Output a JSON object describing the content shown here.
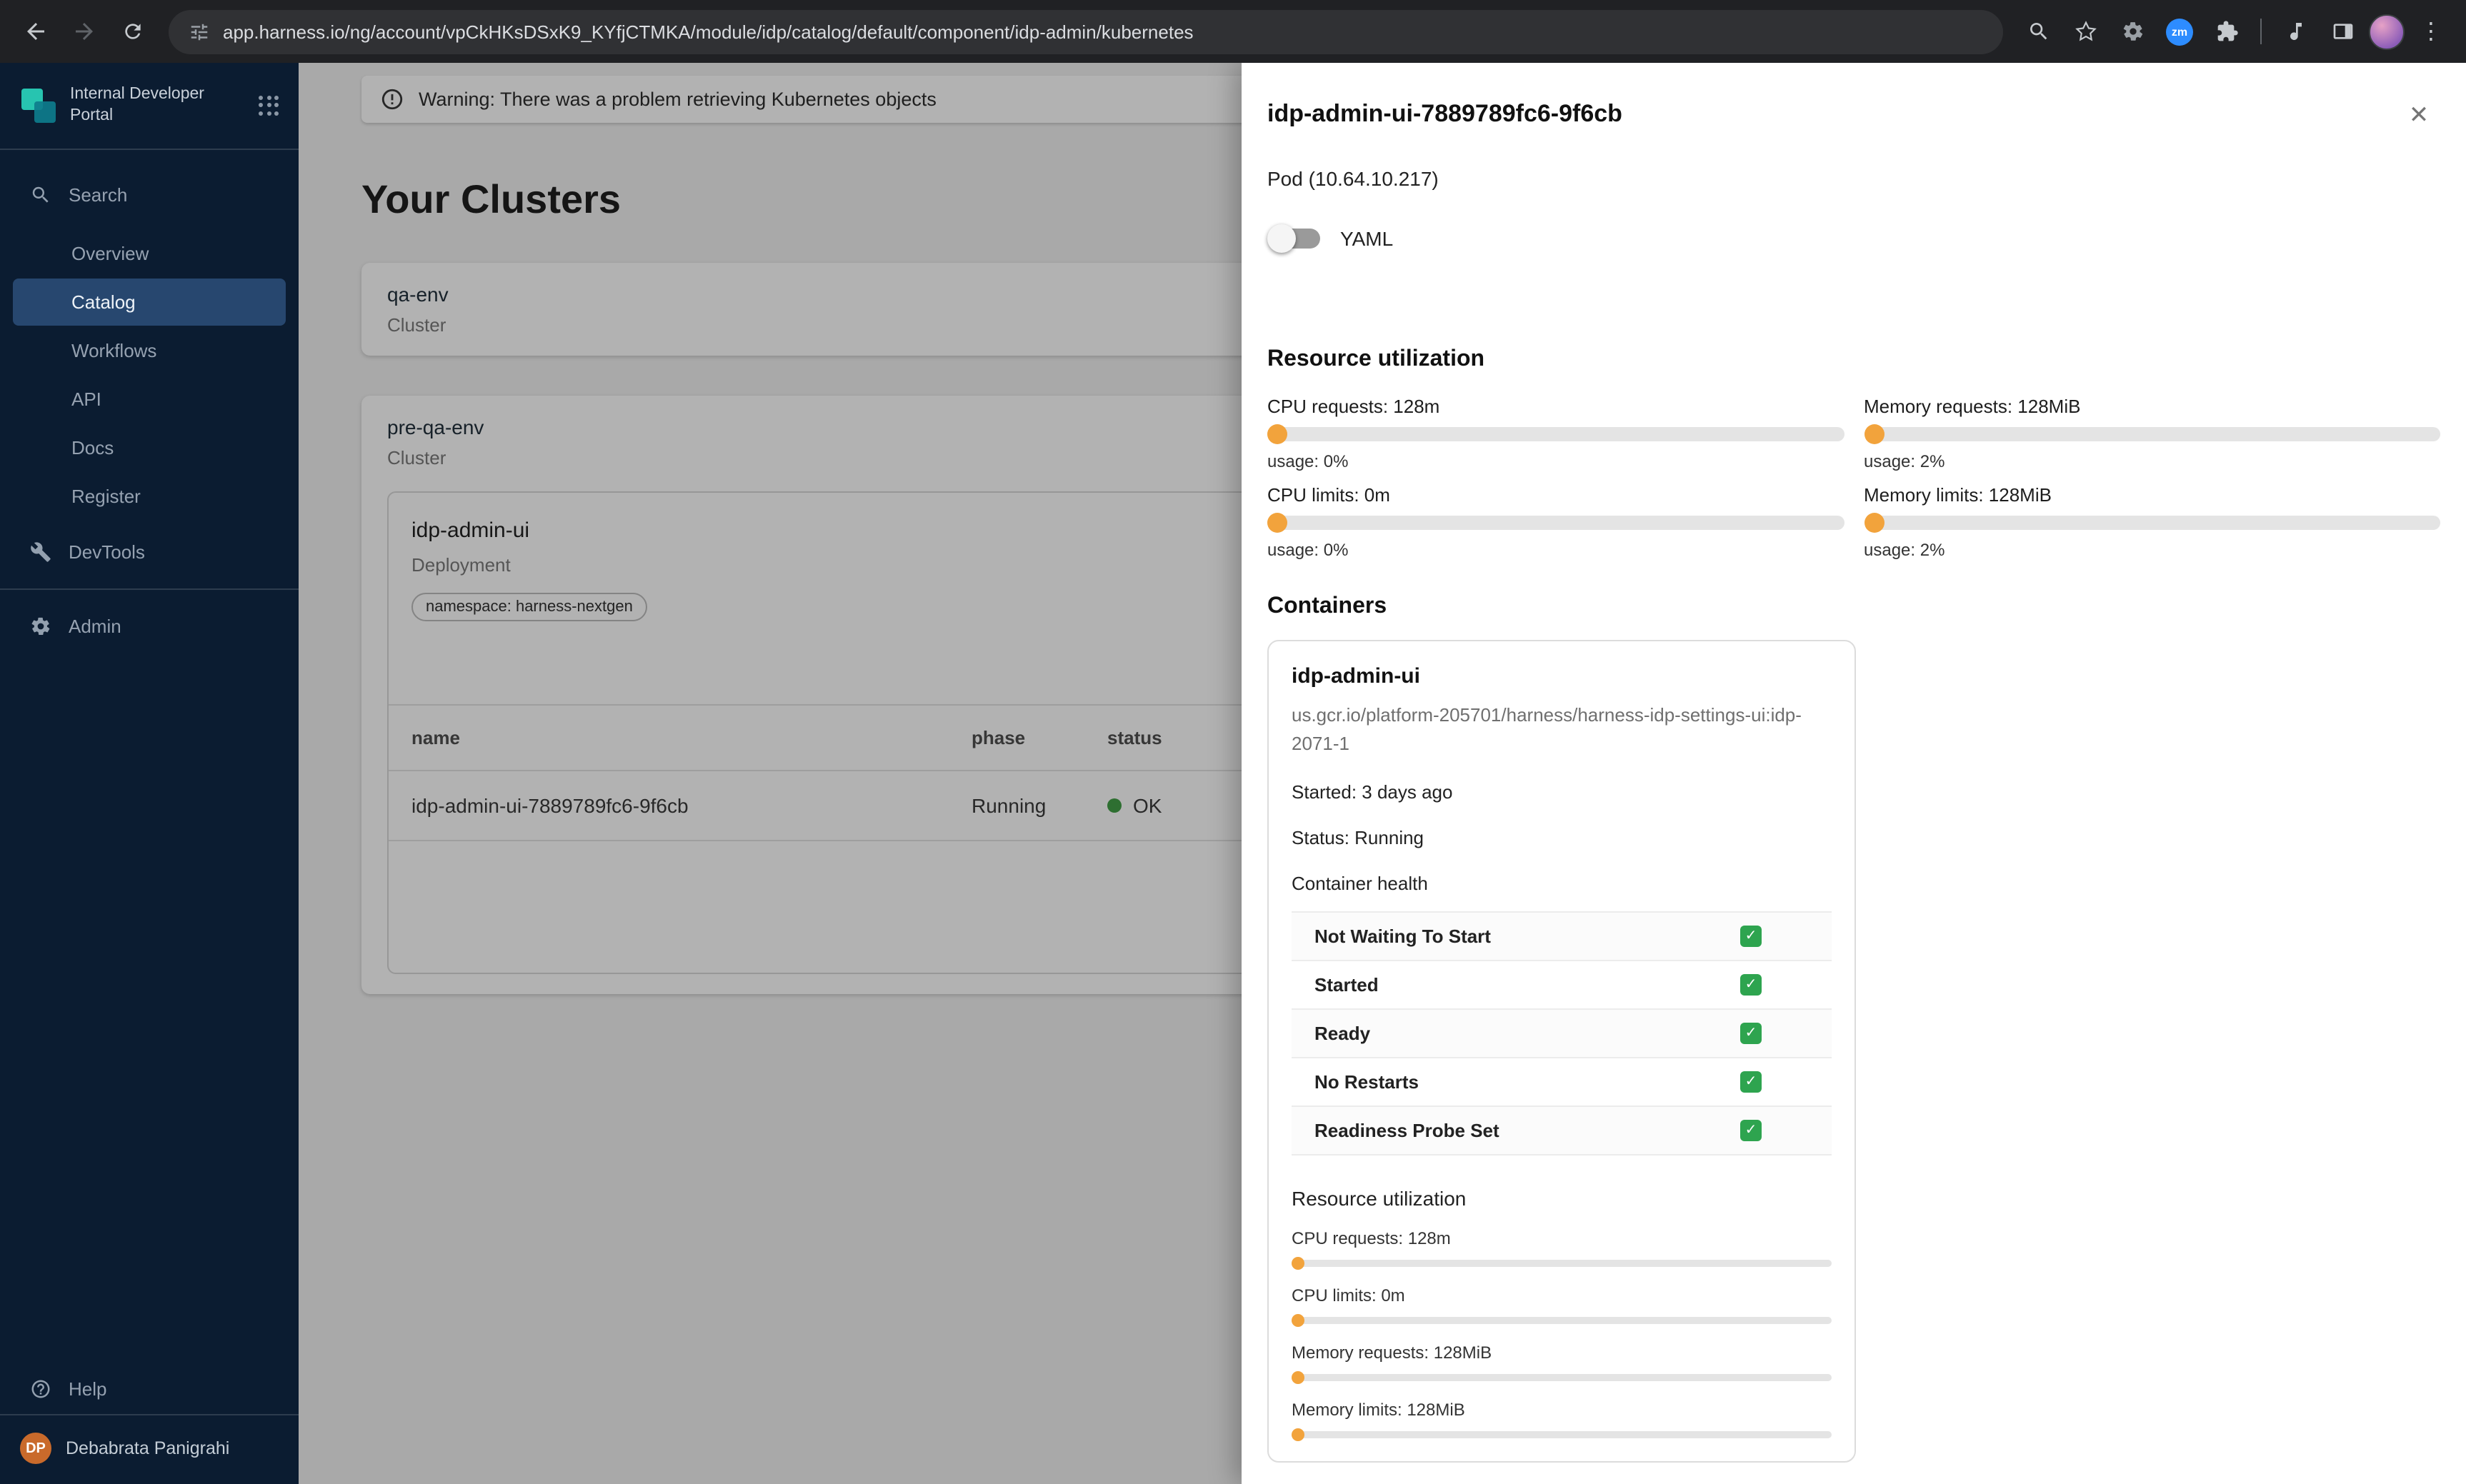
{
  "browser": {
    "url": "app.harness.io/ng/account/vpCkHKsDSxK9_KYfjCTMKA/module/idp/catalog/default/component/idp-admin/kubernetes",
    "zoom_extension_label": "zm"
  },
  "sidebar": {
    "brand": "Internal Developer Portal",
    "search_label": "Search",
    "nav": [
      "Overview",
      "Catalog",
      "Workflows",
      "API",
      "Docs",
      "Register"
    ],
    "devtools_label": "DevTools",
    "admin_label": "Admin",
    "help_label": "Help",
    "user_initials": "DP",
    "user_name": "Debabrata Panigrahi"
  },
  "main": {
    "warning_text": "Warning: There was a problem retrieving Kubernetes objects",
    "heading": "Your Clusters",
    "clusters": [
      {
        "name": "qa-env",
        "kind": "Cluster"
      },
      {
        "name": "pre-qa-env",
        "kind": "Cluster"
      }
    ],
    "workload": {
      "name": "idp-admin-ui",
      "kind": "Deployment",
      "namespace_chip": "namespace: harness-nextgen"
    },
    "pods_table": {
      "columns": [
        "name",
        "phase",
        "status"
      ],
      "rows": [
        {
          "name": "idp-admin-ui-7889789fc6-9f6cb",
          "phase": "Running",
          "status": "OK"
        }
      ]
    }
  },
  "drawer": {
    "title": "idp-admin-ui-7889789fc6-9f6cb",
    "subtitle": "Pod (10.64.10.217)",
    "yaml_label": "YAML",
    "close_glyph": "✕",
    "check_glyph": "✓",
    "resource_utilization_heading": "Resource utilization",
    "pod_meters": [
      {
        "label": "CPU requests: 128m",
        "usage": "usage: 0%"
      },
      {
        "label": "Memory requests: 128MiB",
        "usage": "usage: 2%"
      },
      {
        "label": "CPU limits: 0m",
        "usage": "usage: 0%"
      },
      {
        "label": "Memory limits: 128MiB",
        "usage": "usage: 2%"
      }
    ],
    "containers_heading": "Containers",
    "container": {
      "name": "idp-admin-ui",
      "image": "us.gcr.io/platform-205701/harness/harness-idp-settings-ui:idp-2071-1",
      "started": "Started: 3 days ago",
      "status": "Status: Running",
      "health_heading": "Container health",
      "health_rows": [
        {
          "label": "Not Waiting To Start"
        },
        {
          "label": "Started"
        },
        {
          "label": "Ready"
        },
        {
          "label": "No Restarts"
        },
        {
          "label": "Readiness Probe Set"
        }
      ],
      "resource_utilization_heading": "Resource utilization",
      "container_meters": [
        "CPU requests: 128m",
        "CPU limits: 0m",
        "Memory requests: 128MiB",
        "Memory limits: 128MiB"
      ]
    }
  },
  "colors": {
    "accent_orange": "#F2A33C",
    "success_green": "#43A047",
    "check_green": "#2EA44F",
    "zoom_blue": "#2D8CFF",
    "sidebar_bg": "#0B1C31",
    "sidebar_active": "#27476F"
  }
}
